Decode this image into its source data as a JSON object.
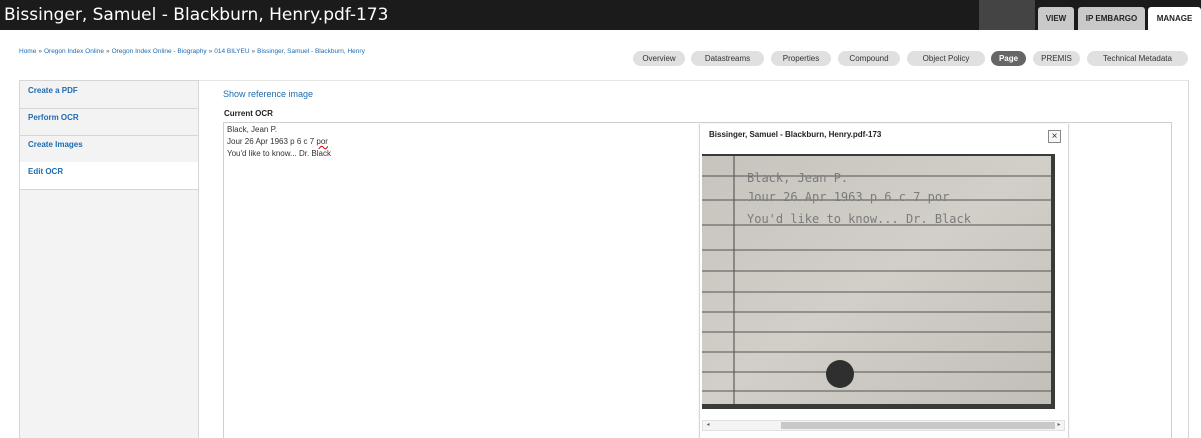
{
  "header": {
    "title": "Bissinger, Samuel - Blackburn, Henry.pdf-173",
    "tabs": [
      "VIEW",
      "IP EMBARGO",
      "MANAGE"
    ]
  },
  "breadcrumb": [
    "Home",
    "Oregon Index Online",
    "Oregon Index Online - Biography",
    "014 BILYEU",
    "Bissinger, Samuel - Blackburn, Henry"
  ],
  "secondary_tabs": [
    "Overview",
    "Datastreams",
    "Properties",
    "Compound",
    "Object Policy",
    "Page",
    "PREMIS",
    "Technical Metadata"
  ],
  "active_secondary_tab": "Page",
  "sidebar": {
    "items": [
      "Create a PDF",
      "Perform OCR",
      "Create Images",
      "Edit OCR"
    ],
    "active": "Edit OCR"
  },
  "main": {
    "show_reference_link": "Show reference image",
    "current_ocr_label": "Current OCR",
    "ocr_lines": [
      "Black, Jean P.",
      "Jour 26 Apr 1963 p 6 c 7 ",
      "You'd like to know... Dr. Black"
    ],
    "ocr_flagged_word": "por"
  },
  "dialog": {
    "title": "Bissinger, Samuel - Blackburn, Henry.pdf-173",
    "close_label": "×",
    "card_lines": [
      "Black, Jean P.",
      "Jour 26 Apr 1963 p 6 c 7   por",
      "You'd like to know... Dr. Black"
    ],
    "scroll_left": "◂",
    "scroll_right": "▸"
  },
  "colors": {
    "link": "#1e6bb0",
    "topbar_bg": "#1b1b1b",
    "active_tab_bg": "#666666",
    "typewriter": "#7b7b7b"
  }
}
